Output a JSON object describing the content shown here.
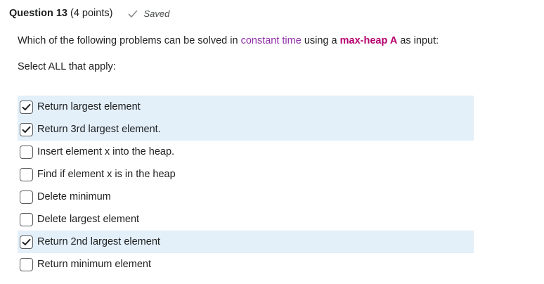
{
  "header": {
    "title": "Question 13",
    "points": "(4 points)",
    "saved_label": "Saved"
  },
  "question": {
    "part1": "Which of the following problems can be solved in ",
    "highlight1": "constant time",
    "part2": " using a ",
    "highlight2": "max-heap A",
    "part3": " as input:"
  },
  "instruction": "Select ALL that apply:",
  "options": [
    {
      "label": "Return largest element",
      "checked": true
    },
    {
      "label": "Return 3rd largest element.",
      "checked": true
    },
    {
      "label": "Insert element x into the heap.",
      "checked": false
    },
    {
      "label": "Find if element x is in the heap",
      "checked": false
    },
    {
      "label": "Delete minimum",
      "checked": false
    },
    {
      "label": "Delete largest element",
      "checked": false
    },
    {
      "label": "Return 2nd largest element",
      "checked": true
    },
    {
      "label": "Return minimum element",
      "checked": false
    }
  ],
  "colors": {
    "highlight_constant": "#8f2ea8",
    "highlight_maxheap": "#b5006e",
    "checked_row_bg": "#e3eff9"
  },
  "icons": {
    "saved": "checkmark-icon",
    "checkbox_checked": "checkbox-checked-icon"
  }
}
